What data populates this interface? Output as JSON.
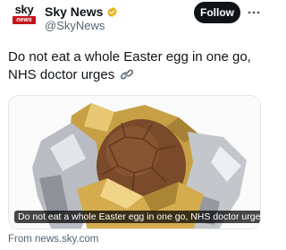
{
  "author": {
    "avatar_logo_text": "sky",
    "avatar_badge_text": "news",
    "display_name": "Sky News",
    "handle": "@SkyNews",
    "verified_badge_color": "#e8b317"
  },
  "actions": {
    "follow_label": "Follow",
    "more_icon": "more-dots-icon"
  },
  "tweet": {
    "text": "Do not eat a whole Easter egg in one go, NHS doctor urges",
    "link_icon": "link-icon"
  },
  "card": {
    "image_description_icon": "chocolate-easter-egg-image",
    "caption": "Do not eat a whole Easter egg in one go, NHS doctor urges",
    "source": "From news.sky.com"
  },
  "colors": {
    "follow_bg": "#0f1419",
    "sky_red": "#c4141b",
    "secondary_text": "#536471"
  }
}
